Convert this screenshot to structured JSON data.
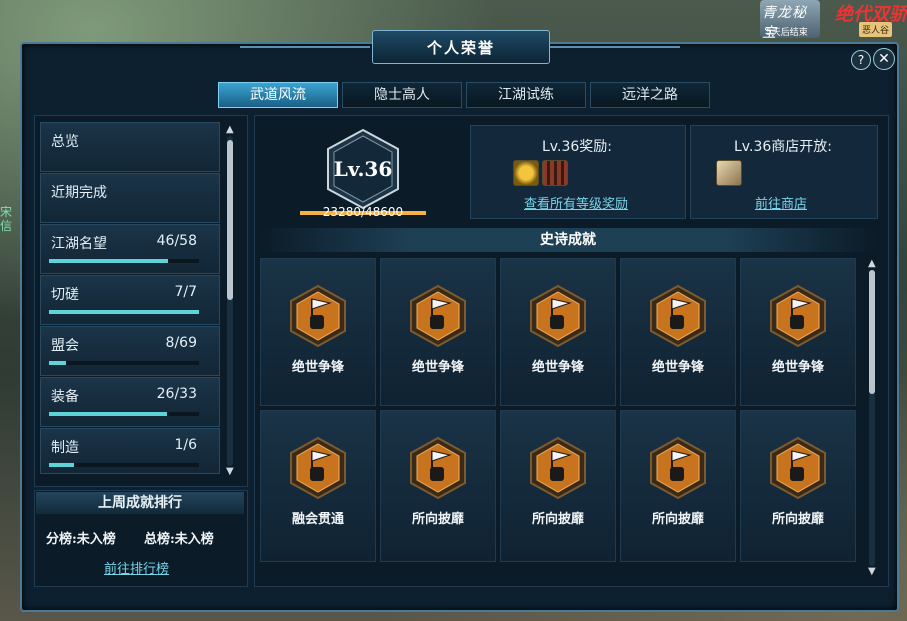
{
  "overlay": {
    "logo1_text": "青龙秘宝",
    "logo1_sub": "5天后结束",
    "logo2_text": "绝代双骄",
    "logo2_sub": "恶人谷",
    "side_text": "宋信"
  },
  "window": {
    "title": "个人荣誉",
    "help_icon": "?",
    "close_icon": "✕"
  },
  "tabs": [
    {
      "label": "武道风流",
      "active": true
    },
    {
      "label": "隐士高人",
      "active": false
    },
    {
      "label": "江湖试练",
      "active": false
    },
    {
      "label": "远洋之路",
      "active": false
    }
  ],
  "nav": [
    {
      "label": "总览",
      "count": "",
      "progress": null
    },
    {
      "label": "近期完成",
      "count": "",
      "progress": null
    },
    {
      "label": "江湖名望",
      "count": "46/58",
      "progress": 0.793
    },
    {
      "label": "切磋",
      "count": "7/7",
      "progress": 1.0
    },
    {
      "label": "盟会",
      "count": "8/69",
      "progress": 0.116
    },
    {
      "label": "装备",
      "count": "26/33",
      "progress": 0.788
    },
    {
      "label": "制造",
      "count": "1/6",
      "progress": 0.167
    }
  ],
  "ranking": {
    "title": "上周成就排行",
    "sub_rank": "分榜:未入榜",
    "total_rank": "总榜:未入榜",
    "link": "前往排行榜"
  },
  "level": {
    "label": "Lv.36",
    "xp_text": "23280/48600",
    "xp_fraction": 0.479
  },
  "rewards": {
    "title": "Lv.36奖励:",
    "link": "查看所有等级奖励"
  },
  "shop": {
    "title": "Lv.36商店开放:",
    "link": "前往商店"
  },
  "epic": {
    "title": "史诗成就",
    "cards": [
      {
        "label": "绝世争锋"
      },
      {
        "label": "绝世争锋"
      },
      {
        "label": "绝世争锋"
      },
      {
        "label": "绝世争锋"
      },
      {
        "label": "绝世争锋"
      },
      {
        "label": "融会贯通"
      },
      {
        "label": "所向披靡"
      },
      {
        "label": "所向披靡"
      },
      {
        "label": "所向披靡"
      },
      {
        "label": "所向披靡"
      }
    ]
  },
  "colors": {
    "accent": "#3aa4d0",
    "progress": "#5fd4d8",
    "xp": "#f5b041",
    "badge": "#c8741e"
  }
}
